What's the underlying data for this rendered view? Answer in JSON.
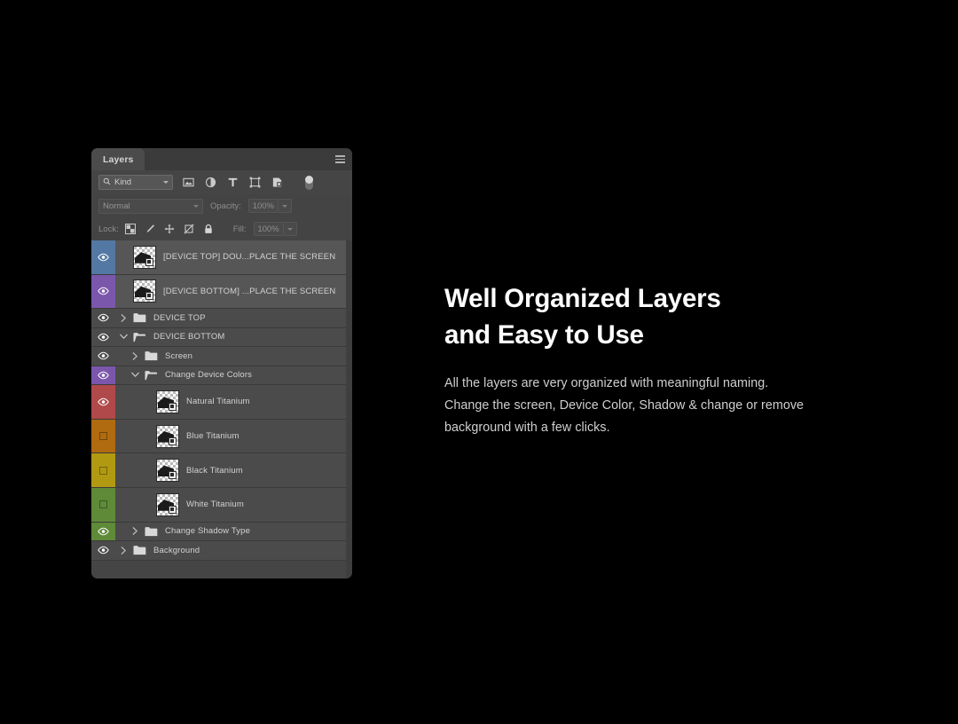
{
  "panel": {
    "tab_label": "Layers",
    "menu_icon": "hamburger-menu-icon",
    "filter": {
      "search_icon": "search-icon",
      "kind_label": "Kind",
      "icons": [
        {
          "name": "pixel-layer-filter-icon",
          "title": "Pixel layers"
        },
        {
          "name": "adjustment-layer-filter-icon",
          "title": "Adjustment layers"
        },
        {
          "name": "type-layer-filter-icon",
          "title": "Type layers"
        },
        {
          "name": "shape-layer-filter-icon",
          "title": "Shape layers"
        },
        {
          "name": "smart-object-filter-icon",
          "title": "Smart objects"
        }
      ],
      "toggle_name": "filter-enable-toggle"
    },
    "blend": {
      "mode": "Normal",
      "opacity_label": "Opacity:",
      "opacity_value": "100%"
    },
    "lock": {
      "label": "Lock:",
      "icons": [
        {
          "name": "lock-transparent-pixels-icon"
        },
        {
          "name": "lock-image-pixels-icon"
        },
        {
          "name": "lock-position-icon"
        },
        {
          "name": "lock-artboard-nesting-icon"
        },
        {
          "name": "lock-all-icon"
        }
      ],
      "fill_label": "Fill:",
      "fill_value": "100%"
    },
    "layers": [
      {
        "name": "[DEVICE TOP] DOU...PLACE THE SCREEN",
        "type": "smart-object",
        "visible": true,
        "selected": true,
        "color": "#5478a4",
        "indent": 0,
        "disclosure": "none"
      },
      {
        "name": "[DEVICE BOTTOM] ...PLACE THE SCREEN",
        "type": "smart-object",
        "visible": true,
        "selected": true,
        "color": "#7b57ab",
        "indent": 0,
        "disclosure": "none"
      },
      {
        "name": "DEVICE TOP",
        "type": "group",
        "visible": true,
        "selected": false,
        "color": "",
        "indent": 0,
        "disclosure": "collapsed"
      },
      {
        "name": "DEVICE BOTTOM",
        "type": "group",
        "visible": true,
        "selected": false,
        "color": "",
        "indent": 0,
        "disclosure": "expanded"
      },
      {
        "name": "Screen",
        "type": "group",
        "visible": true,
        "selected": false,
        "color": "",
        "indent": 1,
        "disclosure": "collapsed"
      },
      {
        "name": "Change Device Colors",
        "type": "group",
        "visible": true,
        "selected": false,
        "color": "#7b57ab",
        "indent": 1,
        "disclosure": "expanded"
      },
      {
        "name": "Natural Titanium",
        "type": "smart-object",
        "visible": true,
        "selected": false,
        "color": "#b04a4a",
        "indent": 2,
        "disclosure": "none"
      },
      {
        "name": "Blue Titanium",
        "type": "smart-object",
        "visible": false,
        "selected": false,
        "color": "#b06a10",
        "indent": 2,
        "disclosure": "none"
      },
      {
        "name": "Black Titanium",
        "type": "smart-object",
        "visible": false,
        "selected": false,
        "color": "#b19a12",
        "indent": 2,
        "disclosure": "none"
      },
      {
        "name": "White Titanium",
        "type": "smart-object",
        "visible": false,
        "selected": false,
        "color": "#5f8a38",
        "indent": 2,
        "disclosure": "none"
      },
      {
        "name": "Change Shadow Type",
        "type": "group",
        "visible": true,
        "selected": false,
        "color": "#5f8a38",
        "indent": 1,
        "disclosure": "collapsed"
      },
      {
        "name": "Background",
        "type": "group",
        "visible": true,
        "selected": false,
        "color": "",
        "indent": 0,
        "disclosure": "collapsed"
      }
    ]
  },
  "copy": {
    "headline_line1": "Well Organized Layers",
    "headline_line2": "and Easy to Use",
    "body_line1": "All the layers are very organized with meaningful naming.",
    "body_line2": "Change the screen, Device Color, Shadow & change or remove",
    "body_line3": "background with a few clicks."
  },
  "theme": {
    "background": "#000000",
    "panel_bg": "#3d3d3d",
    "row_bg": "#4b4b4b",
    "row_selected_bg": "#565656",
    "text_primary": "#ffffff",
    "text_secondary": "#cfcfcf",
    "layer_text": "#d2d2d2"
  }
}
